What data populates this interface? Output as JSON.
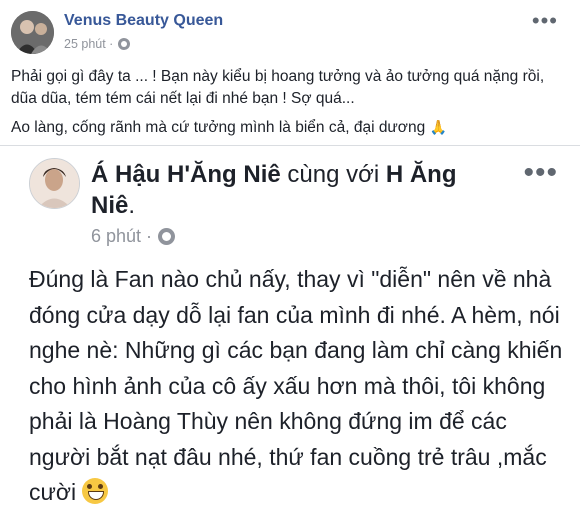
{
  "post": {
    "author": "Venus Beauty Queen",
    "time": "25 phút · ",
    "text_line1": "Phải gọi gì đây ta ... ! Bạn này kiểu bị hoang tưởng và ảo tưởng quá nặng rồi, dũa dũa, tém tém cái nết lại đi nhé bạn ! Sợ quá...",
    "text_line2": "Ao làng, cống rãnh mà cứ tưởng mình là biển cả, đại dương",
    "pray_emoji": "🙏",
    "more_icon": "•••"
  },
  "shared": {
    "author": "Á Hậu H'Ăng Niê",
    "with_text": " cùng với ",
    "tagged": "H Ăng Niê",
    "period": ".",
    "time": "6 phút · ",
    "body": "Đúng là Fan nào chủ nấy, thay vì \"diễn\" nên về nhà đóng cửa dạy dỗ lại fan của mình đi nhé. A hèm, nói nghe nè: Những gì các bạn đang làm chỉ càng khiến cho hình ảnh của cô ấy xấu hơn mà thôi, tôi không phải là Hoàng Thùy nên không đứng im để các người bắt nạt đâu nhé, thứ fan cuồng trẻ trâu ,mắc cười",
    "more_icon": "•••"
  },
  "icons": {
    "globe": "globe-icon",
    "more": "more-options-icon",
    "smile": "grinning-face-icon",
    "pray": "folded-hands-icon"
  }
}
